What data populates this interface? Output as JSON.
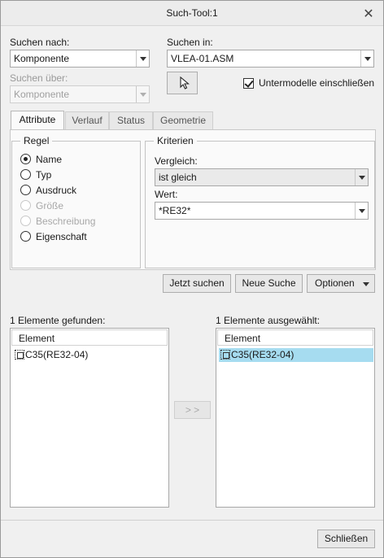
{
  "window": {
    "title": "Such-Tool:1"
  },
  "search_for": {
    "label": "Suchen nach:",
    "value": "Komponente"
  },
  "search_via": {
    "label": "Suchen über:",
    "value": "Komponente"
  },
  "search_in": {
    "label": "Suchen in:",
    "value": "VLEA-01.ASM"
  },
  "include_submodels": {
    "label": "Untermodelle einschließen",
    "checked": true
  },
  "tabs": [
    {
      "label": "Attribute",
      "active": true
    },
    {
      "label": "Verlauf",
      "active": false
    },
    {
      "label": "Status",
      "active": false
    },
    {
      "label": "Geometrie",
      "active": false
    }
  ],
  "rule": {
    "legend": "Regel",
    "options": [
      {
        "label": "Name",
        "checked": true,
        "enabled": true
      },
      {
        "label": "Typ",
        "checked": false,
        "enabled": true
      },
      {
        "label": "Ausdruck",
        "checked": false,
        "enabled": true
      },
      {
        "label": "Größe",
        "checked": false,
        "enabled": false
      },
      {
        "label": "Beschreibung",
        "checked": false,
        "enabled": false
      },
      {
        "label": "Eigenschaft",
        "checked": false,
        "enabled": true
      }
    ]
  },
  "criteria": {
    "legend": "Kriterien",
    "compare_label": "Vergleich:",
    "compare_value": "ist gleich",
    "value_label": "Wert:",
    "value_value": "*RE32*"
  },
  "actions": {
    "search_now": "Jetzt suchen",
    "new_search": "Neue Suche",
    "options": "Optionen"
  },
  "found": {
    "label": "1 Elemente gefunden:",
    "column": "Element",
    "items": [
      "C35(RE32-04)"
    ]
  },
  "transfer": {
    "label": "> >"
  },
  "selected": {
    "label": "1 Elemente ausgewählt:",
    "column": "Element",
    "items": [
      "C35(RE32-04)"
    ]
  },
  "footer": {
    "close": "Schließen"
  },
  "colors": {
    "selection": "#a6dcf0",
    "window_bg": "#f0f0f0"
  }
}
